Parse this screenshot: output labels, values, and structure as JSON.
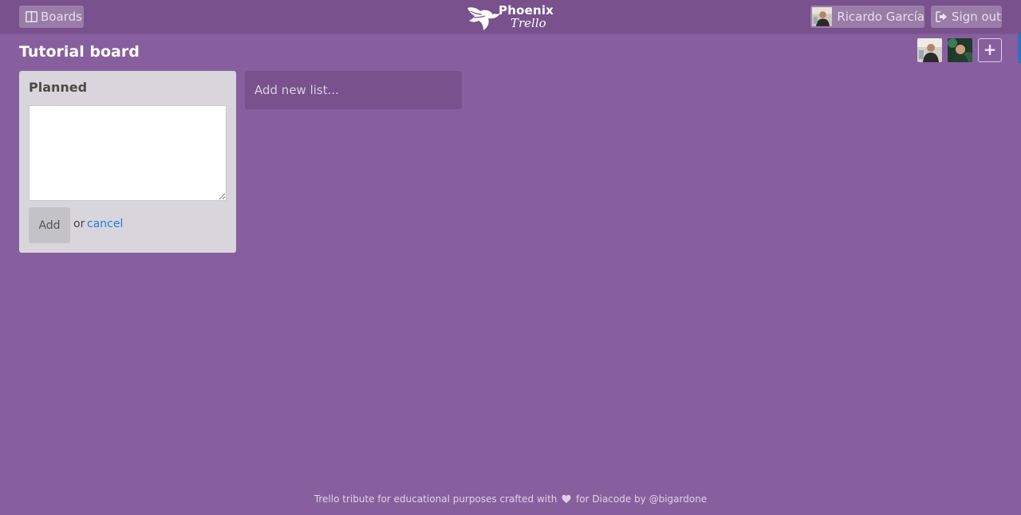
{
  "header": {
    "boards_label": "Boards",
    "logo_primary": "Phoenix",
    "logo_secondary": "Trello",
    "user_name": "Ricardo García",
    "signout_label": "Sign out",
    "icons": {
      "boards": "columns-icon",
      "signout": "sign-out-icon",
      "logo": "phoenix-bird-icon"
    }
  },
  "board": {
    "title": "Tutorial board",
    "add_member_symbol": "+",
    "members": [
      "member-avatar-1",
      "member-avatar-2"
    ]
  },
  "lists": [
    {
      "title": "Planned",
      "new_card_form": {
        "textarea_value": "",
        "add_label": "Add",
        "or_text": "or",
        "cancel_label": "cancel"
      }
    }
  ],
  "add_list": {
    "placeholder": "Add new list..."
  },
  "footer": {
    "text_before": "Trello tribute for educational purposes crafted with",
    "text_after": "for Diacode by @bigardone"
  },
  "colors": {
    "background": "#885f9e",
    "header": "#78518d",
    "list_bg": "#d8d6dc",
    "link": "#2a7ad4"
  }
}
